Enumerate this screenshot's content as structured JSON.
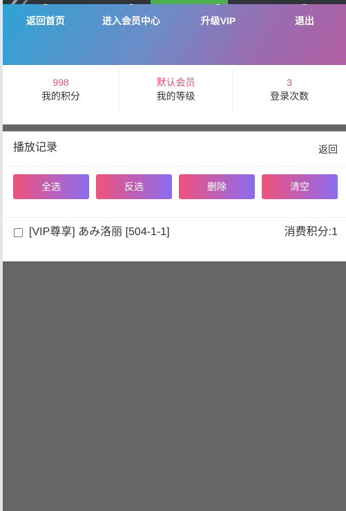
{
  "nav": {
    "items": [
      {
        "label": "返回首页",
        "icon": "circle-icon"
      },
      {
        "label": "进入会员中心",
        "icon": "circle-icon"
      },
      {
        "label": "升级VIP",
        "icon": "circle-icon"
      },
      {
        "label": "退出",
        "icon": "circle-icon"
      }
    ],
    "active_index": 2
  },
  "stats": [
    {
      "value": "998",
      "label": "我的积分"
    },
    {
      "value": "默认会员",
      "label": "我的等级"
    },
    {
      "value": "3",
      "label": "登录次数"
    }
  ],
  "history": {
    "title": "播放记录",
    "back_label": "返回",
    "buttons": {
      "select_all": "全选",
      "invert": "反选",
      "delete": "删除",
      "clear": "清空"
    },
    "items": [
      {
        "title": "[VIP尊享] あみ洛丽 [504-1-1]",
        "points": "消费积分:1",
        "checked": false
      }
    ]
  },
  "colors": {
    "accent": "#f0506e",
    "gradient_start": "#f0527a",
    "gradient_end": "#8b6cf0",
    "hero_start": "#2ea3d6",
    "hero_end": "#b05fa0",
    "active_nav": "#4caf50",
    "background": "#666666"
  }
}
